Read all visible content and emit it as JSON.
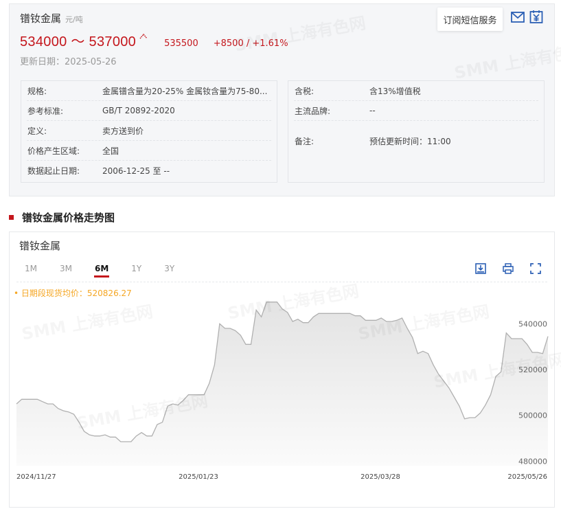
{
  "product": {
    "title": "镨钕金属",
    "unit": "元/吨",
    "price_range": "534000 ～ 537000",
    "average": "535500",
    "change": "+8500  /  +1.61%",
    "update_label": "更新日期：",
    "update_date": "2025-05-26"
  },
  "actions": {
    "subscribe_label": "订阅短信服务"
  },
  "spec_left": [
    {
      "label": "规格:",
      "value": "金属镨含量为20-25% 金属钕含量为75-80..."
    },
    {
      "label": "参考标准:",
      "value": "GB/T 20892-2020"
    },
    {
      "label": "定义:",
      "value": "卖方送到价"
    },
    {
      "label": "价格产生区域:",
      "value": "全国"
    },
    {
      "label": "数据起止日期:",
      "value": "2006-12-25 至 --"
    }
  ],
  "spec_right": [
    {
      "label": "含税:",
      "value": "含13%增值税"
    },
    {
      "label": "主流品牌:",
      "value": "--"
    },
    {
      "label": "备注:",
      "value": "预估更新时间：11:00"
    }
  ],
  "section": {
    "title": "镨钕金属价格走势图"
  },
  "chart_card": {
    "title": "镨钕金属",
    "tabs": [
      "1M",
      "3M",
      "6M",
      "1Y",
      "3Y"
    ],
    "active_tab": "6M",
    "avg_label": "• 日期段现货均价：520826.27"
  },
  "watermark_text": "SMM 上海有色网",
  "colors": {
    "accent_red": "#c4161c",
    "avg_orange": "#f5a623",
    "line": "#b0b0b0",
    "icon_blue": "#2b5fb4"
  },
  "chart_data": {
    "type": "area",
    "title": "",
    "xlabel": "",
    "ylabel": "",
    "x_ticks": [
      "2024/11/27",
      "2025/01/23",
      "2025/03/28",
      "2025/05/26"
    ],
    "y_ticks": [
      480000,
      500000,
      520000,
      540000
    ],
    "ylim": [
      478000,
      550000
    ],
    "grid": false,
    "series": [
      {
        "values": [
          505000,
          507000,
          507000,
          507000,
          507000,
          506000,
          505000,
          505000,
          503000,
          502000,
          501500,
          500500,
          497000,
          493000,
          491500,
          491000,
          491000,
          491500,
          490500,
          490500,
          488500,
          488500,
          488500,
          491000,
          492500,
          491000,
          491000,
          496000,
          497000,
          504000,
          505000,
          504500,
          506500,
          509000,
          509000,
          509000,
          509000,
          514000,
          522000,
          540000,
          538000,
          538000,
          537000,
          535000,
          531000,
          531000,
          546000,
          543000,
          549500,
          549500,
          549500,
          546500,
          545000,
          541000,
          542000,
          540500,
          540500,
          543000,
          544500,
          544500,
          544500,
          544500,
          544500,
          544500,
          544500,
          543500,
          543500,
          541500,
          541500,
          541500,
          542500,
          541000,
          541000,
          541500,
          542500,
          538000,
          534000,
          527000,
          528000,
          527000,
          522000,
          518000,
          515000,
          512000,
          508000,
          504000,
          498500,
          499000,
          499000,
          501000,
          504500,
          509000,
          517000,
          519000,
          536000,
          533500,
          533500,
          533500,
          531000,
          527500,
          527500,
          527000,
          534500
        ]
      }
    ]
  }
}
